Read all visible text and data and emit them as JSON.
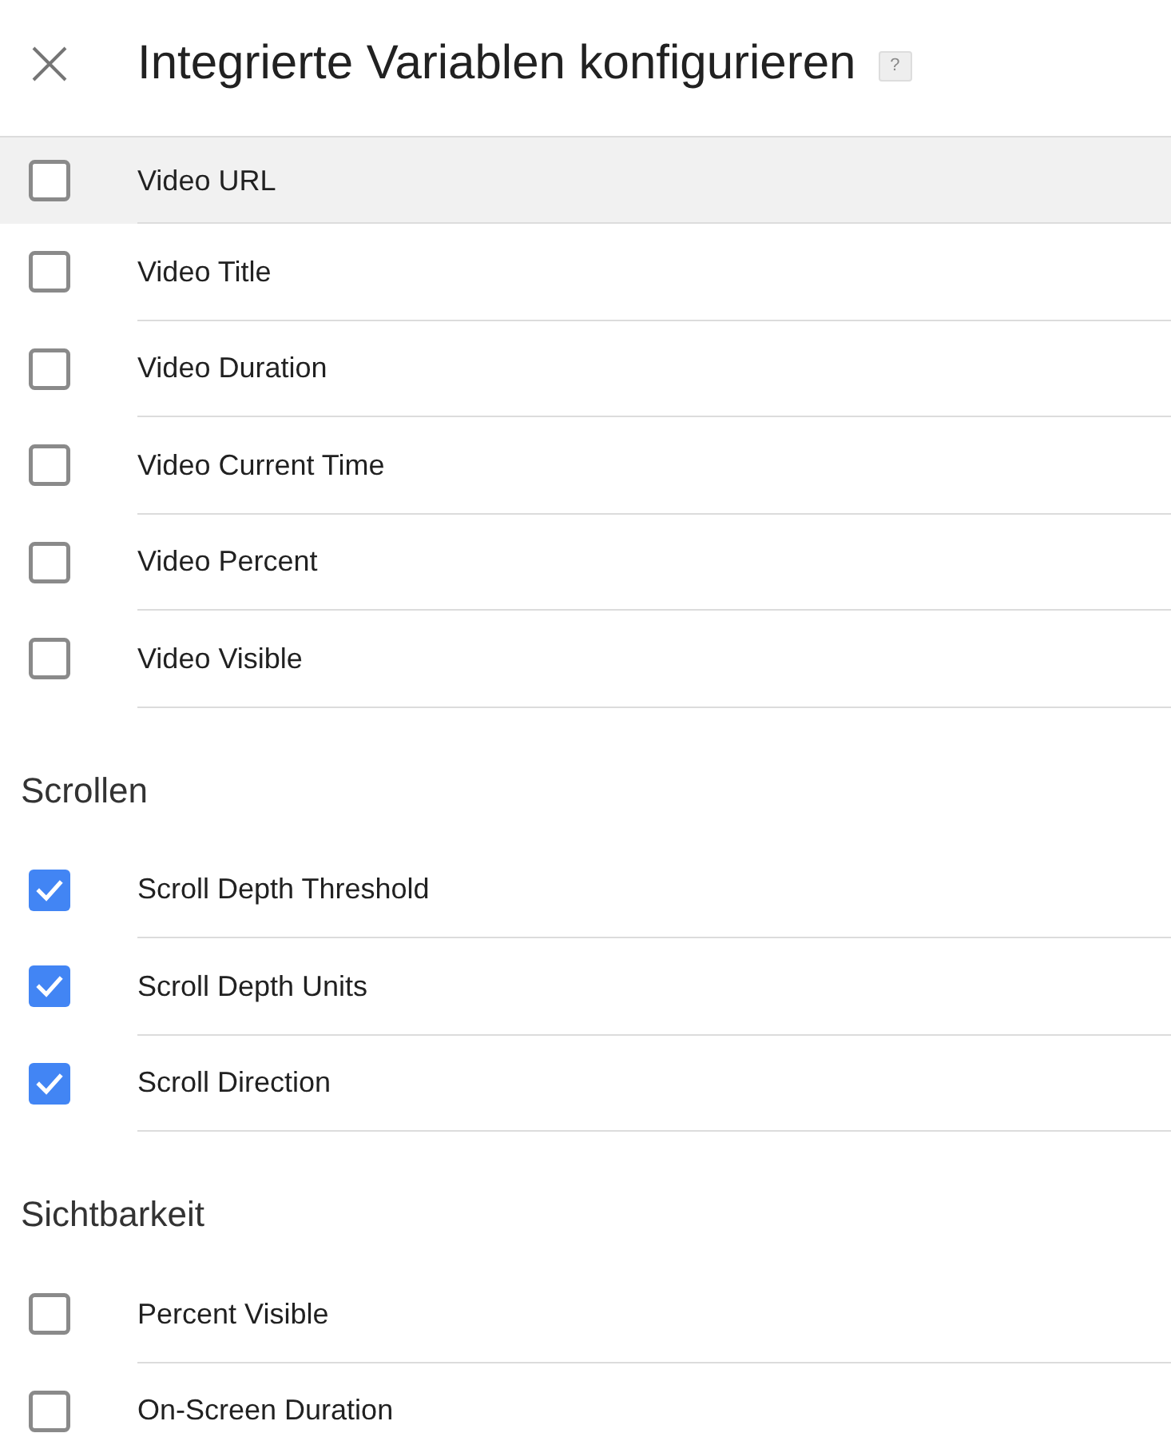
{
  "header": {
    "title": "Integrierte Variablen konfigurieren",
    "help_label": "?"
  },
  "sections": [
    {
      "items": [
        {
          "label": "Video URL",
          "checked": false,
          "highlighted": true
        },
        {
          "label": "Video Title",
          "checked": false,
          "highlighted": false
        },
        {
          "label": "Video Duration",
          "checked": false,
          "highlighted": false
        },
        {
          "label": "Video Current Time",
          "checked": false,
          "highlighted": false
        },
        {
          "label": "Video Percent",
          "checked": false,
          "highlighted": false
        },
        {
          "label": "Video Visible",
          "checked": false,
          "highlighted": false
        }
      ]
    },
    {
      "heading": "Scrollen",
      "items": [
        {
          "label": "Scroll Depth Threshold",
          "checked": true,
          "highlighted": false
        },
        {
          "label": "Scroll Depth Units",
          "checked": true,
          "highlighted": false
        },
        {
          "label": "Scroll Direction",
          "checked": true,
          "highlighted": false
        }
      ]
    },
    {
      "heading": "Sichtbarkeit",
      "items": [
        {
          "label": "Percent Visible",
          "checked": false,
          "highlighted": false
        },
        {
          "label": "On-Screen Duration",
          "checked": false,
          "highlighted": false
        }
      ]
    }
  ]
}
